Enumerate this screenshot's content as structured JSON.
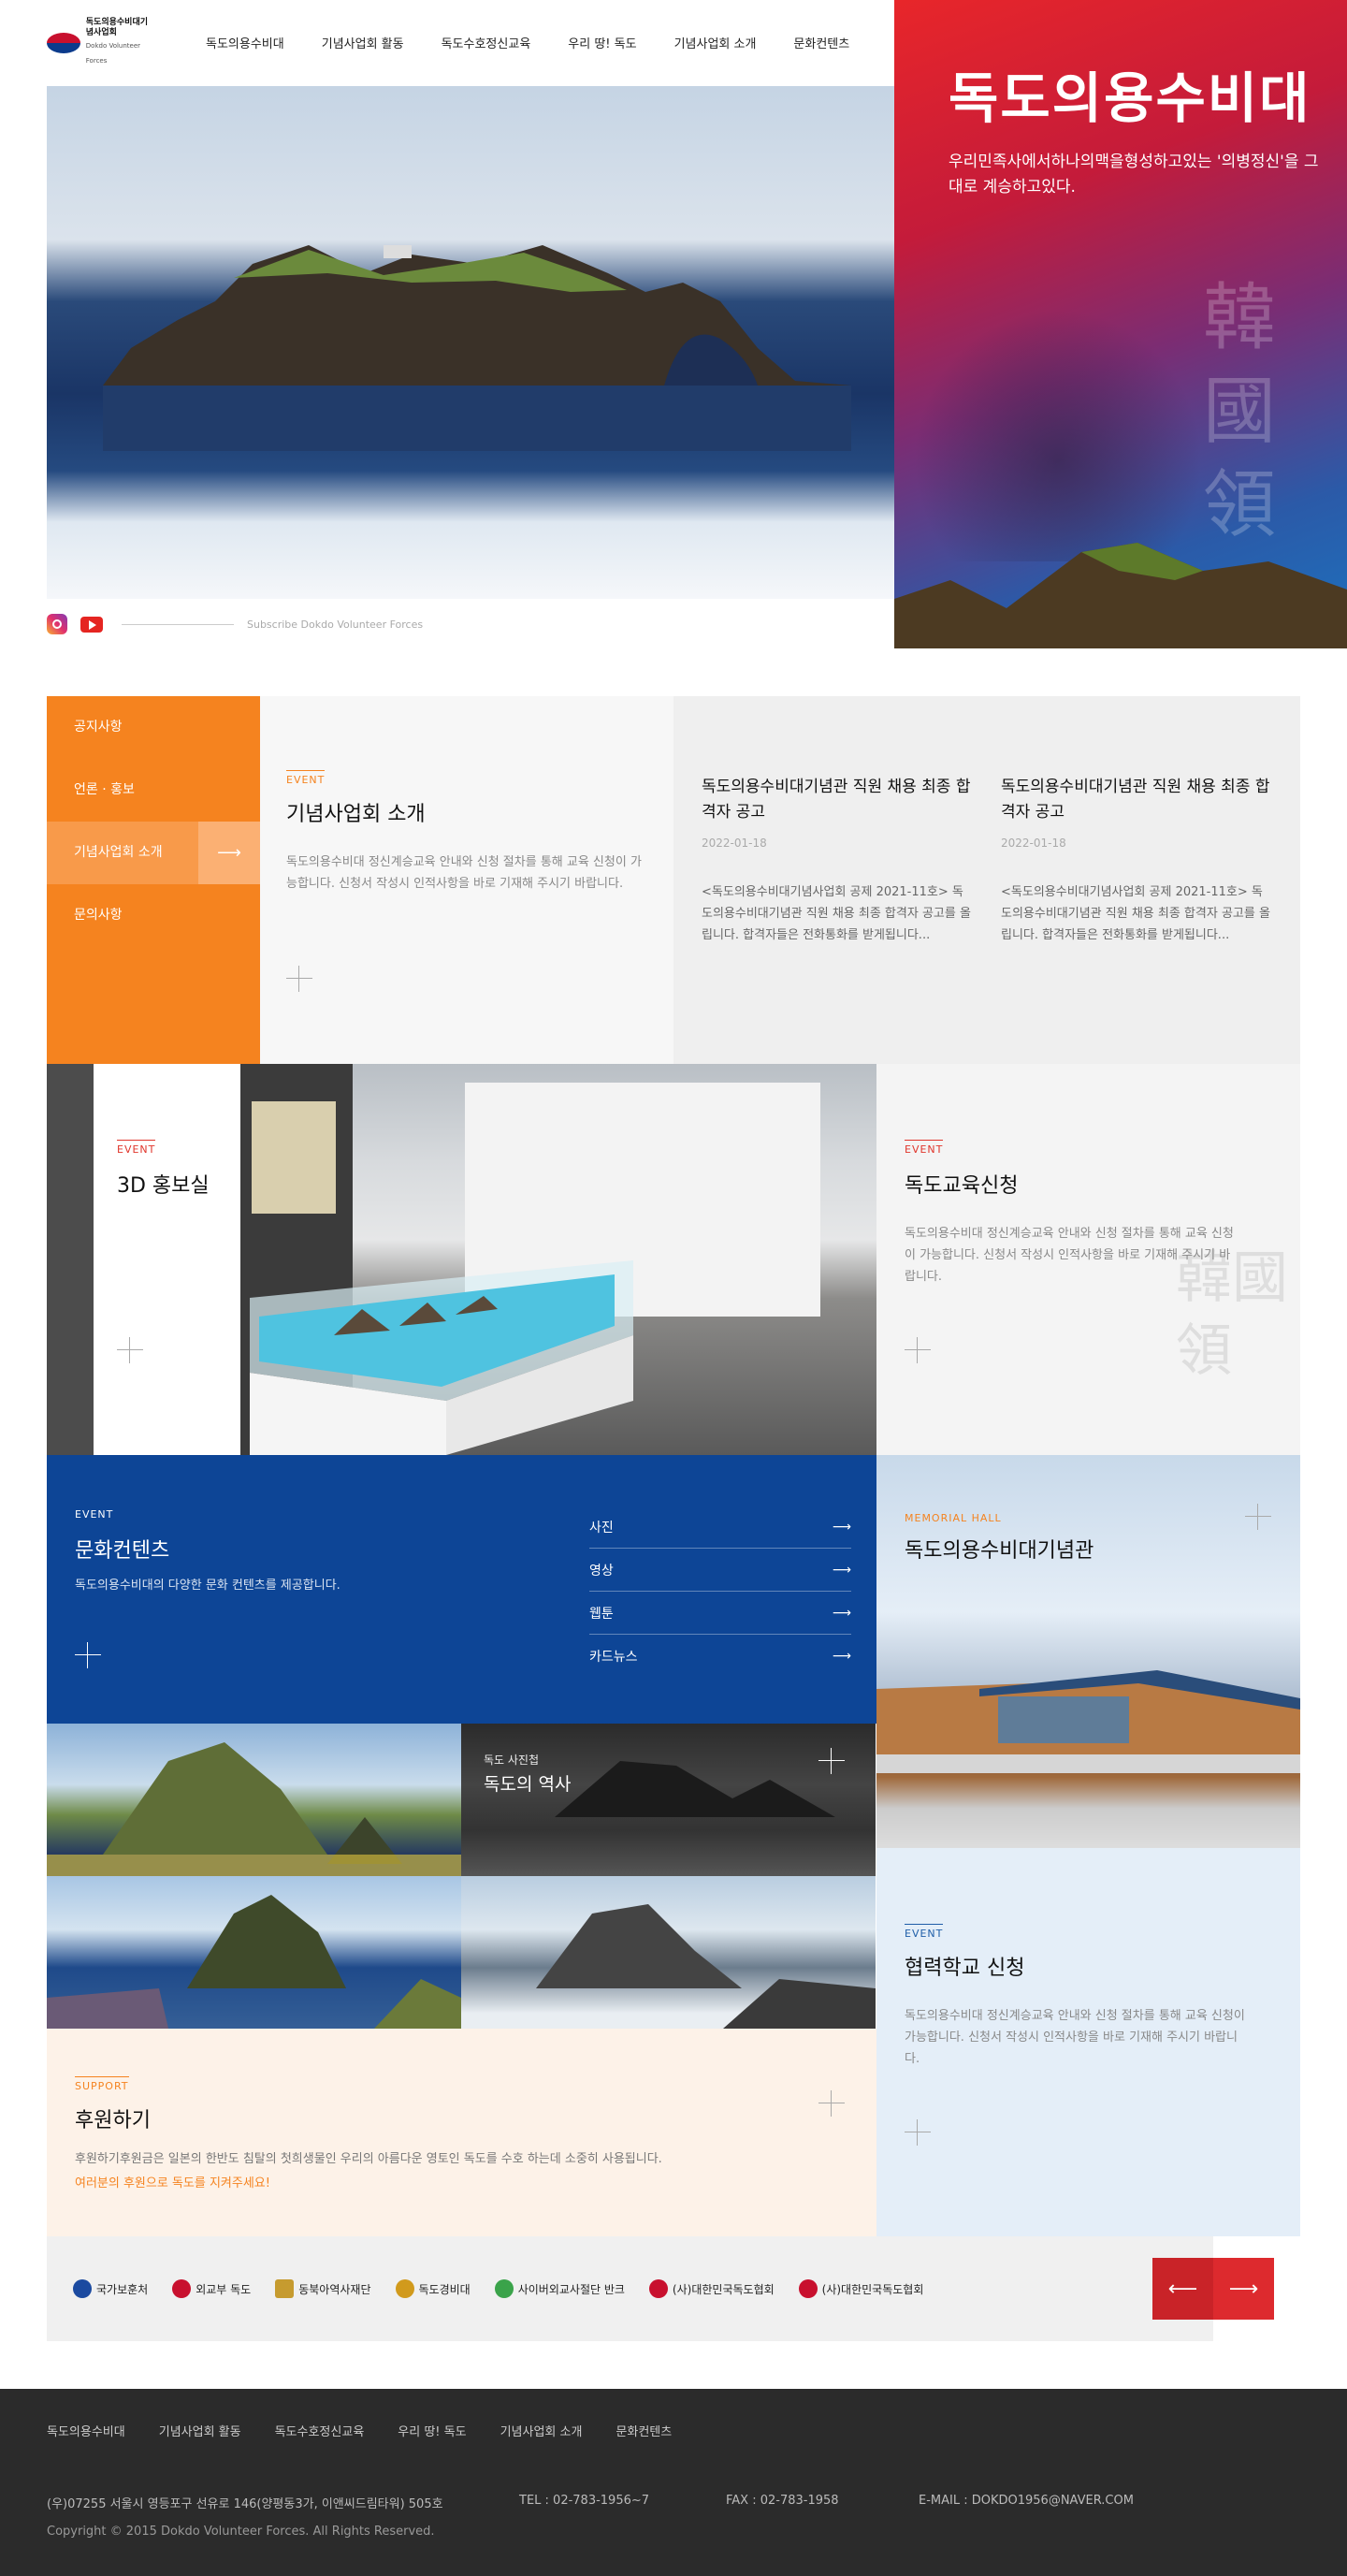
{
  "header": {
    "logo_name": "독도의용수비대기념사업회",
    "logo_sub": "Dokdo Volunteer Forces",
    "nav": [
      "독도의용수비대",
      "기념사업회 활동",
      "독도수호정신교육",
      "우리 땅! 독도",
      "기념사업회 소개",
      "문화컨텐츠"
    ]
  },
  "banner": {
    "title": "독도의용수비대",
    "desc": "우리민족사에서하나의맥을형성하고있는 '의병정신'을 그대로 계승하고있다.",
    "seal": "韓國領"
  },
  "social": {
    "subscribe": "Subscribe Dokdo Volunteer Forces"
  },
  "board": {
    "menu": [
      "공지사항",
      "언론 · 홍보",
      "기념사업회 소개",
      "문의사항"
    ],
    "active_arrow": "⟶",
    "intro": {
      "tag": "EVENT",
      "title": "기념사업회 소개",
      "desc": "독도의용수비대 정신계승교육 안내와 신청 절차를 통해 교육 신청이 가능합니다. 신청서 작성시 인적사항을 바로 기재해 주시기 바랍니다."
    },
    "news": [
      {
        "title": "독도의용수비대기념관 직원 채용 최종 합격자 공고",
        "date": "2022-01-18",
        "body": "<독도의용수비대기념사업회 공제 2021-11호> 독도의용수비대기념관 직원 채용 최종 합격자 공고를 올립니다. 합격자들은 전화통화를 받게됩니다..."
      },
      {
        "title": "독도의용수비대기념관 직원 채용 최종 합격자 공고",
        "date": "2022-01-18",
        "body": "<독도의용수비대기념사업회 공제 2021-11호> 독도의용수비대기념관 직원 채용 최종 합격자 공고를 올립니다. 합격자들은 전화통화를 받게됩니다..."
      }
    ]
  },
  "vr": {
    "tag": "EVENT",
    "title": "3D 홍보실"
  },
  "edu": {
    "tag": "EVENT",
    "title": "독도교육신청",
    "desc": "독도의용수비대 정신계승교육 안내와 신청 절차를 통해 교육 신청이 가능합니다. 신청서 작성시 인적사항을 바로 기재해 주시기 바랍니다.",
    "seal": "韓國領"
  },
  "culture": {
    "tag": "EVENT",
    "title": "문화컨텐츠",
    "desc": "독도의용수비대의 다양한 문화 컨텐츠를 제공합니다.",
    "links": [
      "사진",
      "영상",
      "웹툰",
      "카드뉴스"
    ],
    "arrow": "⟶"
  },
  "memorial": {
    "tag": "MEMORIAL HALL",
    "title": "독도의용수비대기념관"
  },
  "gallery": {
    "sub": "독도 사진첩",
    "title": "독도의 역사"
  },
  "partner": {
    "tag": "EVENT",
    "title": "협력학교 신청",
    "desc": "독도의용수비대 정신계승교육 안내와 신청 절차를 통해 교육 신청이 가능합니다. 신청서 작성시 인적사항을 바로 기재해 주시기 바랍니다."
  },
  "support": {
    "tag": "SUPPORT",
    "title": "후원하기",
    "desc": "후원하기후원금은 일본의 한반도 침탈의 첫희생물인 우리의 아름다운 영토인 독도를 수호 하는데 소중히 사용됩니다.",
    "cta": "여러분의 후원으로 독도를 지켜주세요!"
  },
  "logos": [
    {
      "name": "국가보훈처",
      "color": "#1b4aa0"
    },
    {
      "name": "외교부 독도",
      "color": "#c8102e"
    },
    {
      "name": "동북아역사재단",
      "color": "#c69b2f"
    },
    {
      "name": "독도경비대",
      "color": "#d19a1c"
    },
    {
      "name": "사이버외교사절단 반크",
      "color": "#3aa34a"
    },
    {
      "name": "(사)대한민국독도협회",
      "color": "#c8102e"
    },
    {
      "name": "(사)대한민국독도협회",
      "color": "#c8102e"
    }
  ],
  "logo_nav": {
    "prev": "⟵",
    "next": "⟶"
  },
  "footer": {
    "nav": [
      "독도의용수비대",
      "기념사업회 활동",
      "독도수호정신교육",
      "우리 땅! 독도",
      "기념사업회 소개",
      "문화컨텐츠"
    ],
    "address": "(우)07255 서울시 영등포구 선유로 146(양평동3가, 이앤씨드림타워) 505호",
    "tel": "TEL : 02-783-1956~7",
    "fax": "FAX : 02-783-1958",
    "email": "E-MAIL : DOKDO1956@NAVER.COM",
    "copyright": "Copyright © 2015 Dokdo Volunteer Forces. All Rights Reserved."
  }
}
